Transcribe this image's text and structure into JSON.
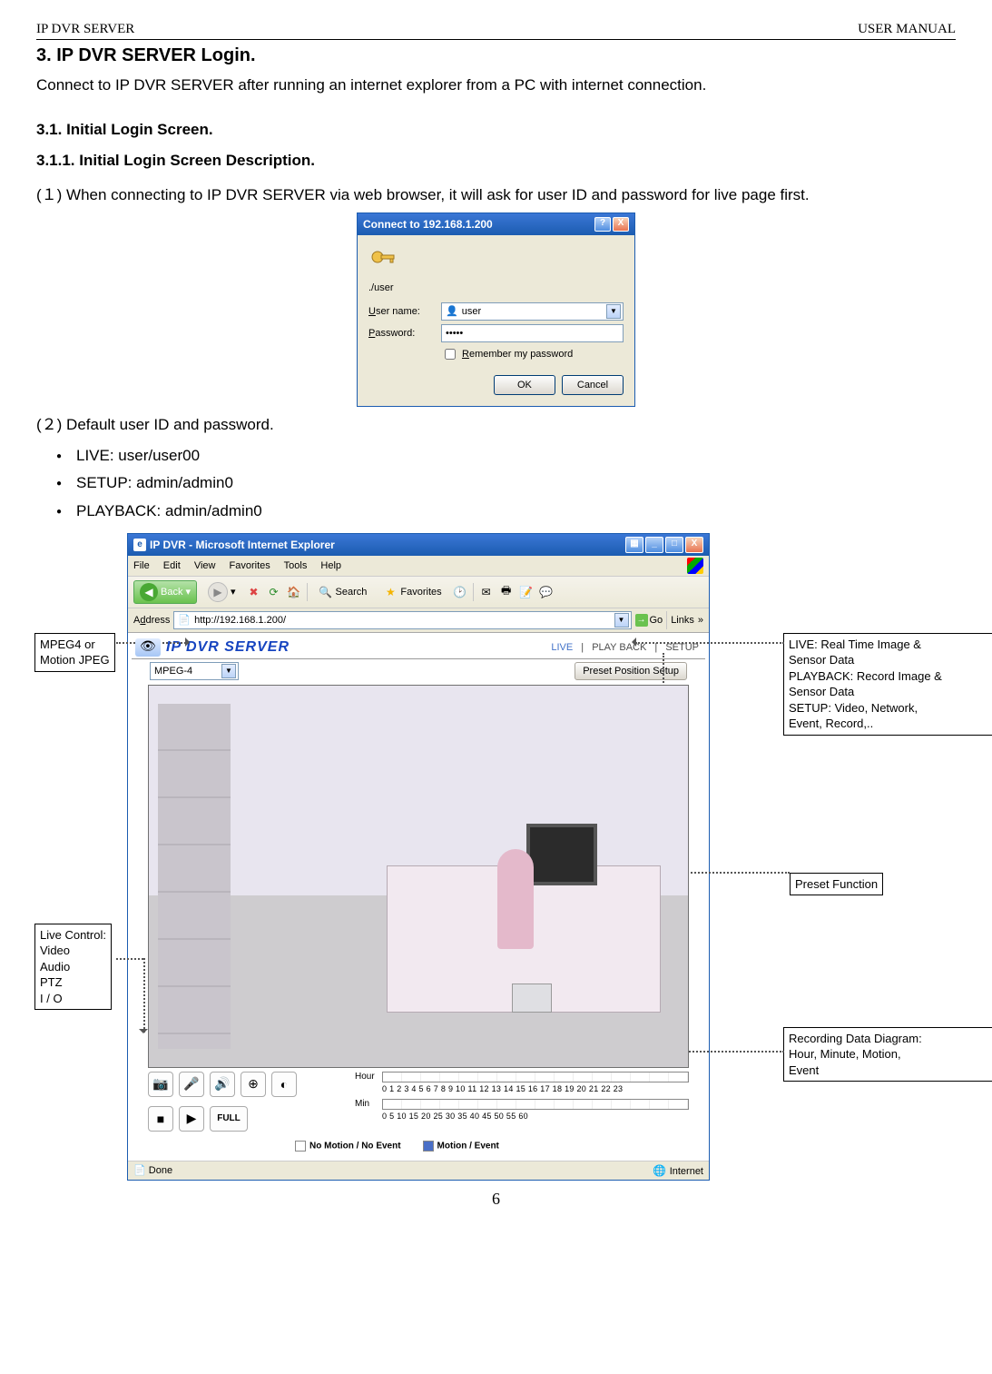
{
  "header": {
    "left": "IP DVR SERVER",
    "right": "USER MANUAL"
  },
  "section": {
    "title": "3. IP DVR SERVER Login.",
    "intro": "Connect to IP DVR SERVER after running an internet explorer from a PC with internet connection.",
    "sub1": "3.1. Initial Login Screen.",
    "sub2": "3.1.1.  Initial Login Screen Description.",
    "step1": "(１) When connecting to IP DVR SERVER via web browser, it will ask for user ID and password for live page first.",
    "step2": "(２) Default user ID and password.",
    "defaults": [
      "LIVE: user/user00",
      "SETUP: admin/admin0",
      "PLAYBACK: admin/admin0"
    ]
  },
  "dialog": {
    "title": "Connect to 192.168.1.200",
    "realm": "./user",
    "userLabel": "User name:",
    "passLabel": "Password:",
    "userValue": "user",
    "passValue": "•••••",
    "remember": "Remember my password",
    "ok": "OK",
    "cancel": "Cancel"
  },
  "browser": {
    "title": "IP DVR - Microsoft Internet Explorer",
    "menu": {
      "file": "File",
      "edit": "Edit",
      "view": "View",
      "favorites": "Favorites",
      "tools": "Tools",
      "help": "Help"
    },
    "toolbar": {
      "back": "Back",
      "search": "Search",
      "favorites": "Favorites"
    },
    "address": {
      "label": "Address",
      "value": "http://192.168.1.200/",
      "go": "Go",
      "links": "Links",
      "chevron": "»"
    },
    "brand": "IP DVR SERVER",
    "tabs": {
      "live": "LIVE",
      "playback": "PLAY BACK",
      "setup": "SETUP",
      "sep": " | "
    },
    "stream": "MPEG-4",
    "preset": "Preset Position Setup",
    "legend": {
      "none": "No Motion / No Event",
      "event": "Motion / Event"
    },
    "timeline": {
      "hourLabel": "Hour",
      "hourTicks": "0   1   2   3   4   5   6   7   8   9   10  11  12  13  14  15  16  17  18  19  20  21  22  23",
      "minLabel": "Min",
      "minTicks": "0      5      10     15     20     25     30     35     40     45     50     55     60"
    },
    "ctrlFull": "FULL",
    "status": {
      "done": "Done",
      "zone": "Internet"
    }
  },
  "annotations": {
    "mpeg": "MPEG4 or\nMotion JPEG",
    "menu": "LIVE: Real Time Image &\n      Sensor Data\nPLAYBACK: Record Image &\n      Sensor Data\nSETUP: Video, Network,\n      Event, Record,..",
    "preset": "Preset Function",
    "livectrl": "Live Control:\n     Video\n     Audio\n     PTZ\n     I / O",
    "rec": "Recording Data Diagram:\n   Hour, Minute, Motion,\n   Event"
  },
  "pageNumber": "6"
}
